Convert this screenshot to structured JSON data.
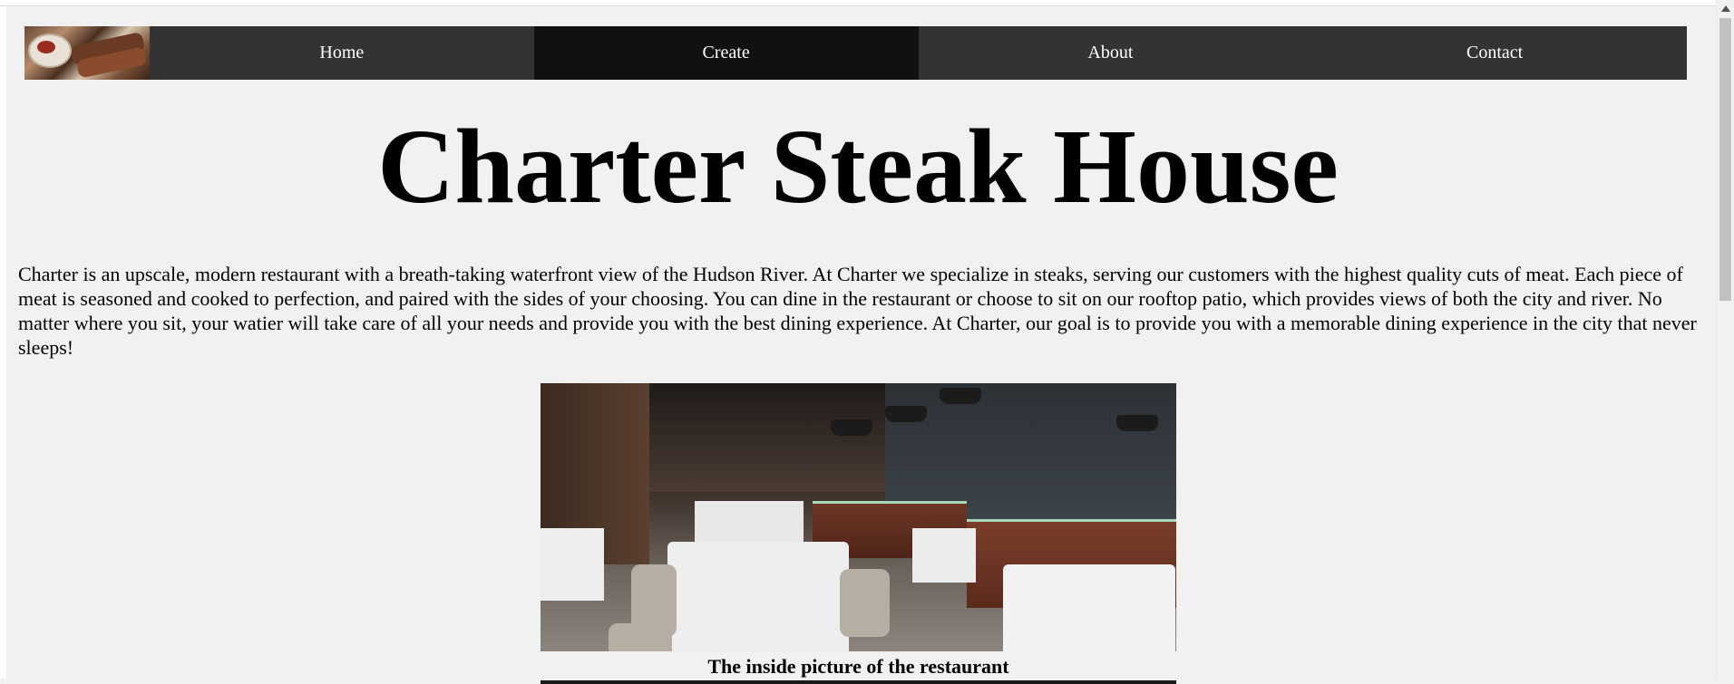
{
  "nav": {
    "logo_alt": "steak-dish-logo",
    "items": [
      {
        "label": "Home",
        "active": false
      },
      {
        "label": "Create",
        "active": true
      },
      {
        "label": "About",
        "active": false
      },
      {
        "label": "Contact",
        "active": false
      }
    ]
  },
  "main": {
    "title": "Charter Steak House",
    "intro": "Charter is an upscale, modern restaurant with a breath-taking waterfront view of the Hudson River. At Charter we specialize in steaks, serving our customers with the highest quality cuts of meat. Each piece of meat is seasoned and cooked to perfection, and paired with the sides of your choosing. You can dine in the restaurant or choose to sit on our rooftop patio, which provides views of both the city and river. No matter where you sit, your watier will take care of all your needs and provide you with the best dining experience. At Charter, our goal is to provide you with a memorable dining experience in the city that never sleeps!",
    "photo_caption": "The inside picture of the restaurant"
  },
  "colors": {
    "nav_bg": "#333333",
    "nav_active_bg": "#111111",
    "page_bg": "#f1f1f1",
    "text": "#000000"
  }
}
